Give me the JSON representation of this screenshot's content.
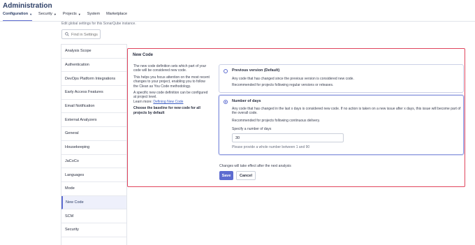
{
  "header": {
    "title": "Administration",
    "nav": [
      {
        "label": "Configuration",
        "dropdown": true,
        "active": true
      },
      {
        "label": "Security",
        "dropdown": true
      },
      {
        "label": "Projects",
        "dropdown": true
      },
      {
        "label": "System"
      },
      {
        "label": "Marketplace"
      }
    ]
  },
  "intro": "Edit global settings for this SonarQube instance.",
  "search": {
    "placeholder": "Find in Settings",
    "value": ""
  },
  "sidebar": {
    "items": [
      "Analysis Scope",
      "Authentication",
      "DevOps Platform Integrations",
      "Early Access Features",
      "Email Notification",
      "External Analyzers",
      "General",
      "Housekeeping",
      "JaCoCo",
      "Languages",
      "Mode",
      "New Code",
      "SCM",
      "Security"
    ],
    "active": "New Code"
  },
  "content": {
    "title": "New Code",
    "desc1": "The new code definition sets which part of your code will be considered new code.",
    "desc2": "This helps you focus attention on the most recent changes to your project, enabling you to follow the Clean as You Code methodology.",
    "desc3": "A specific new code definition can be configured at project level.",
    "learn_more": "Learn more:",
    "learn_link": "Defining New Code",
    "choose": "Choose the baseline for new code for all projects by default",
    "option_previous": {
      "title": "Previous version (Default)",
      "line1": "Any code that has changed since the previous version is considered new code.",
      "line2": "Recommended for projects following regular versions or releases."
    },
    "option_days": {
      "title": "Number of days",
      "line1": "Any code that has changed in the last x days is considered new code. If no action is taken on a new issue after x days, this issue will become part of the overall code.",
      "line2": "Recommended for projects following continuous delivery.",
      "label": "Specify a number of days",
      "value": "30",
      "hint": "Please provide a whole number between 1 and 90"
    },
    "effect_note": "Changes will take effect after the next analysis",
    "save_label": "Save",
    "cancel_label": "Cancel"
  },
  "colors": {
    "accent": "#5d6cd0",
    "highlight_border": "#e0445c",
    "title": "#2c3e66"
  }
}
